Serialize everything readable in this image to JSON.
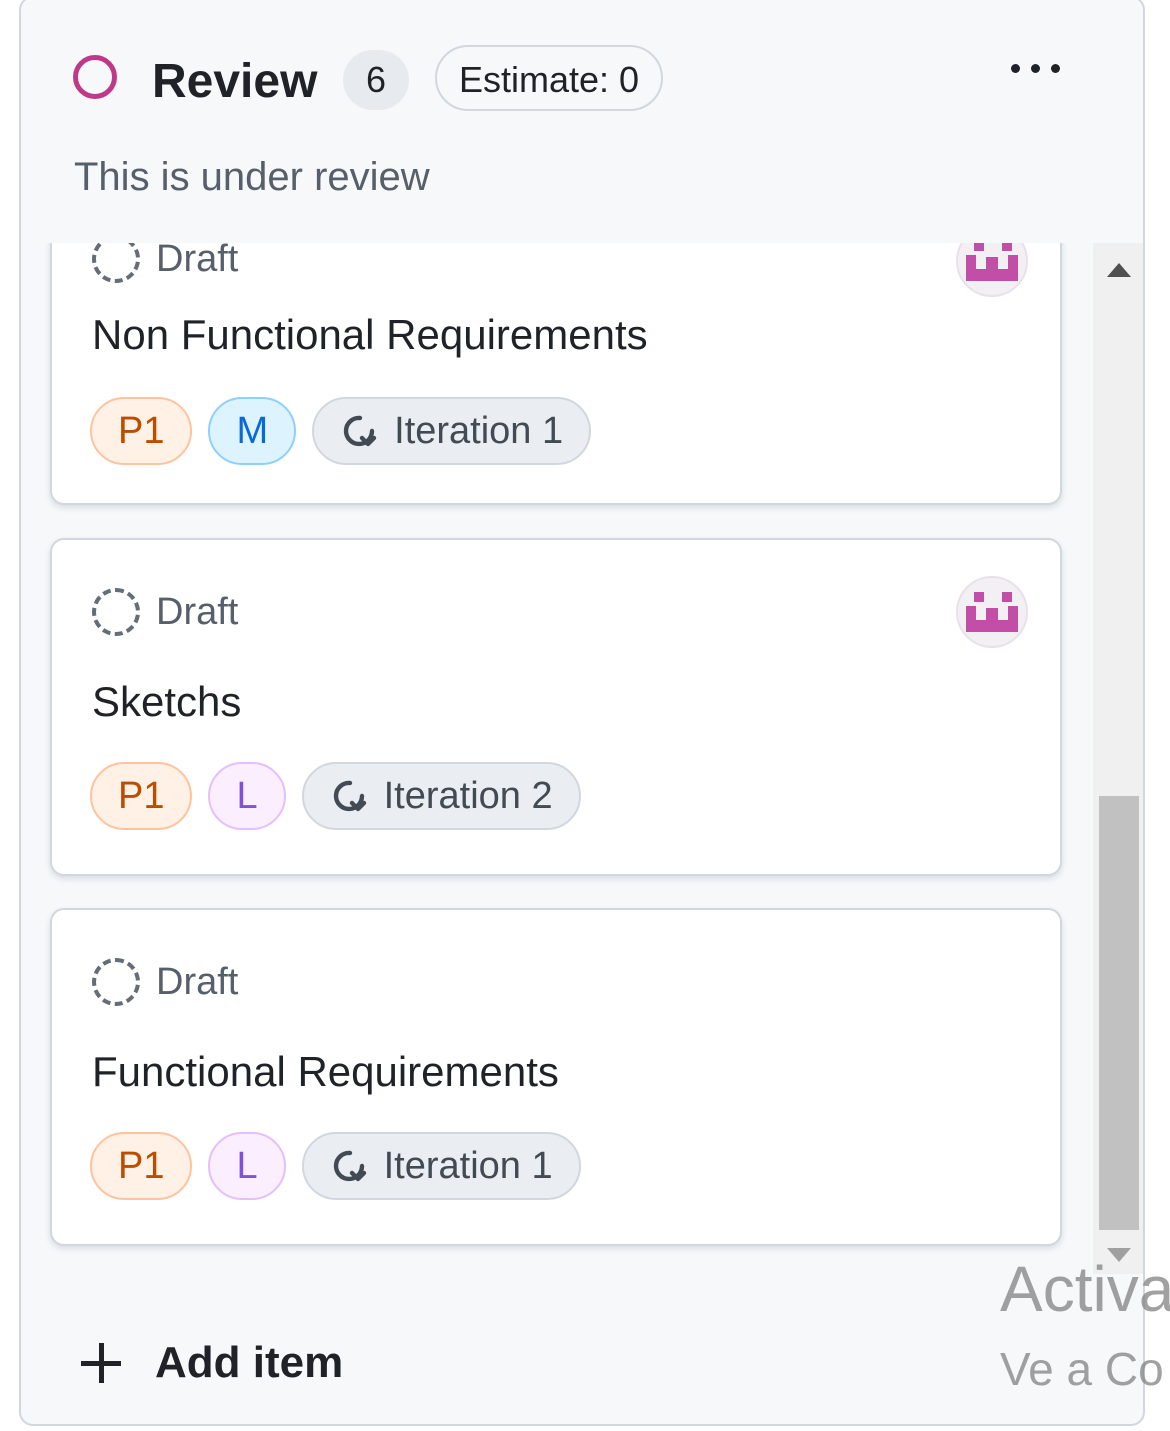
{
  "column": {
    "title": "Review",
    "count": "6",
    "estimate": "Estimate: 0",
    "description": "This is under review",
    "status_color": "#bf3989",
    "more_icon": "kebab-horizontal-icon"
  },
  "cards": [
    {
      "status": "Draft",
      "title": "Non Functional Requirements",
      "priority": "P1",
      "size": "M",
      "iteration": "Iteration 1",
      "assignee_avatar": "identicon-avatar"
    },
    {
      "status": "Draft",
      "title": "Sketchs",
      "priority": "P1",
      "size": "L",
      "iteration": "Iteration 2",
      "assignee_avatar": "identicon-avatar"
    },
    {
      "status": "Draft",
      "title": "Functional Requirements",
      "priority": "P1",
      "size": "L",
      "iteration": "Iteration 1"
    }
  ],
  "footer": {
    "add_item": "Add item"
  },
  "watermark": {
    "line1": "Activa",
    "line2": "Ve a Co"
  }
}
